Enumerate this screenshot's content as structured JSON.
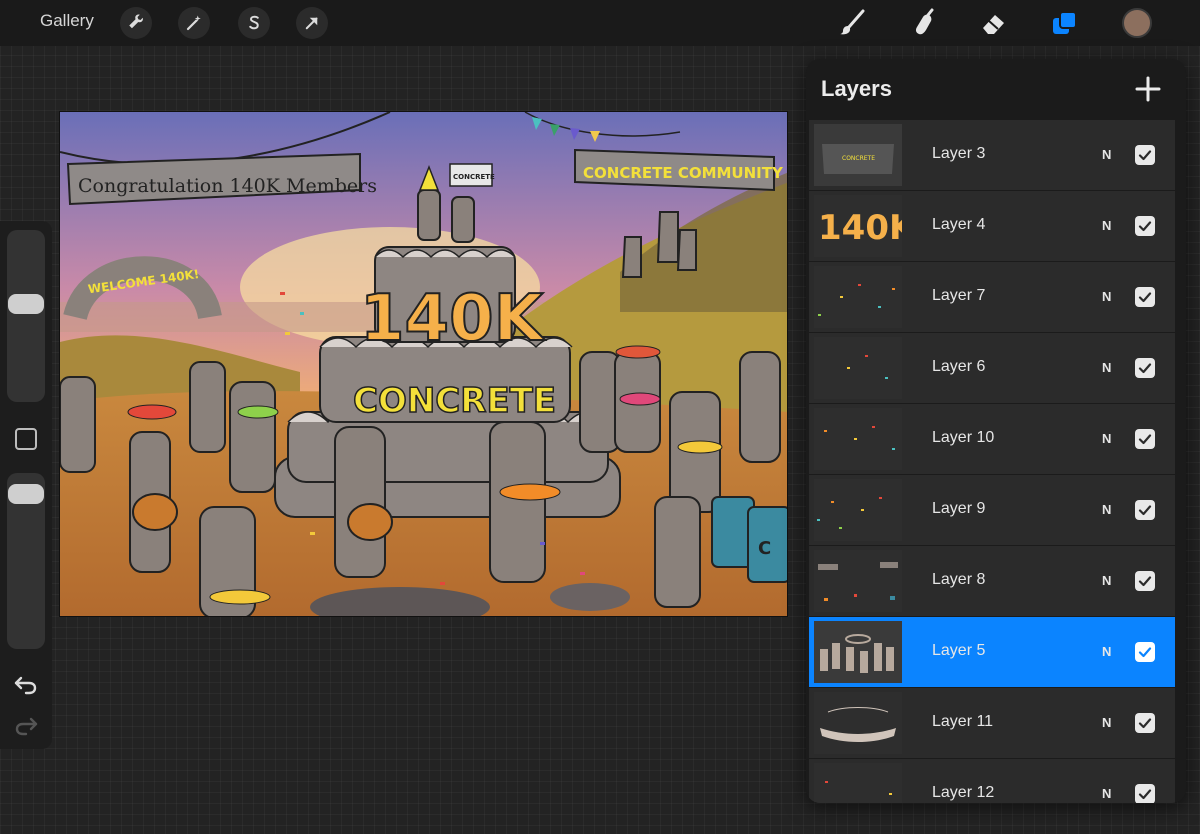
{
  "topbar": {
    "gallery_label": "Gallery",
    "left_tools": [
      "wrench-icon",
      "magic-wand-icon",
      "selection-s-icon",
      "transform-arrow-icon"
    ],
    "right_tools": [
      "brush-icon",
      "smudge-icon",
      "eraser-icon",
      "layers-icon"
    ],
    "active_tool": "layers-icon",
    "current_color": "#8c6f5e"
  },
  "sidebar": {
    "brush_size_level": 0.42,
    "opacity_level": 0.05,
    "undo_icon": "undo-icon",
    "redo_icon": "redo-icon"
  },
  "canvas": {
    "banner_left": "Congratulation 140K Members",
    "banner_right": "CONCRETE COMMUNITY",
    "arch_sign": "WELCOME 140K!",
    "flag_text": "CONCRETE",
    "cake_big_text": "140K",
    "cake_sub_text": "CONCRETE",
    "drum_letter": "C"
  },
  "layers_panel": {
    "title": "Layers",
    "add_icon": "plus-icon",
    "layers": [
      {
        "name": "Layer 3",
        "blend": "N",
        "visible": true,
        "selected": false,
        "thumb_text": "CONCRETE"
      },
      {
        "name": "Layer 4",
        "blend": "N",
        "visible": true,
        "selected": false,
        "thumb_text": "140K"
      },
      {
        "name": "Layer 7",
        "blend": "N",
        "visible": true,
        "selected": false,
        "thumb_text": ""
      },
      {
        "name": "Layer 6",
        "blend": "N",
        "visible": true,
        "selected": false,
        "thumb_text": ""
      },
      {
        "name": "Layer 10",
        "blend": "N",
        "visible": true,
        "selected": false,
        "thumb_text": ""
      },
      {
        "name": "Layer 9",
        "blend": "N",
        "visible": true,
        "selected": false,
        "thumb_text": ""
      },
      {
        "name": "Layer 8",
        "blend": "N",
        "visible": true,
        "selected": false,
        "thumb_text": ""
      },
      {
        "name": "Layer 5",
        "blend": "N",
        "visible": true,
        "selected": true,
        "thumb_text": ""
      },
      {
        "name": "Layer 11",
        "blend": "N",
        "visible": true,
        "selected": false,
        "thumb_text": ""
      },
      {
        "name": "Layer 12",
        "blend": "N",
        "visible": true,
        "selected": false,
        "thumb_text": ""
      }
    ]
  },
  "colors": {
    "accent": "#0b84ff",
    "panel_bg": "#1b1b1b",
    "row_bg": "#2b2b2b",
    "cake_text": "#f5b04a",
    "banner_text": "#f3e03a"
  }
}
